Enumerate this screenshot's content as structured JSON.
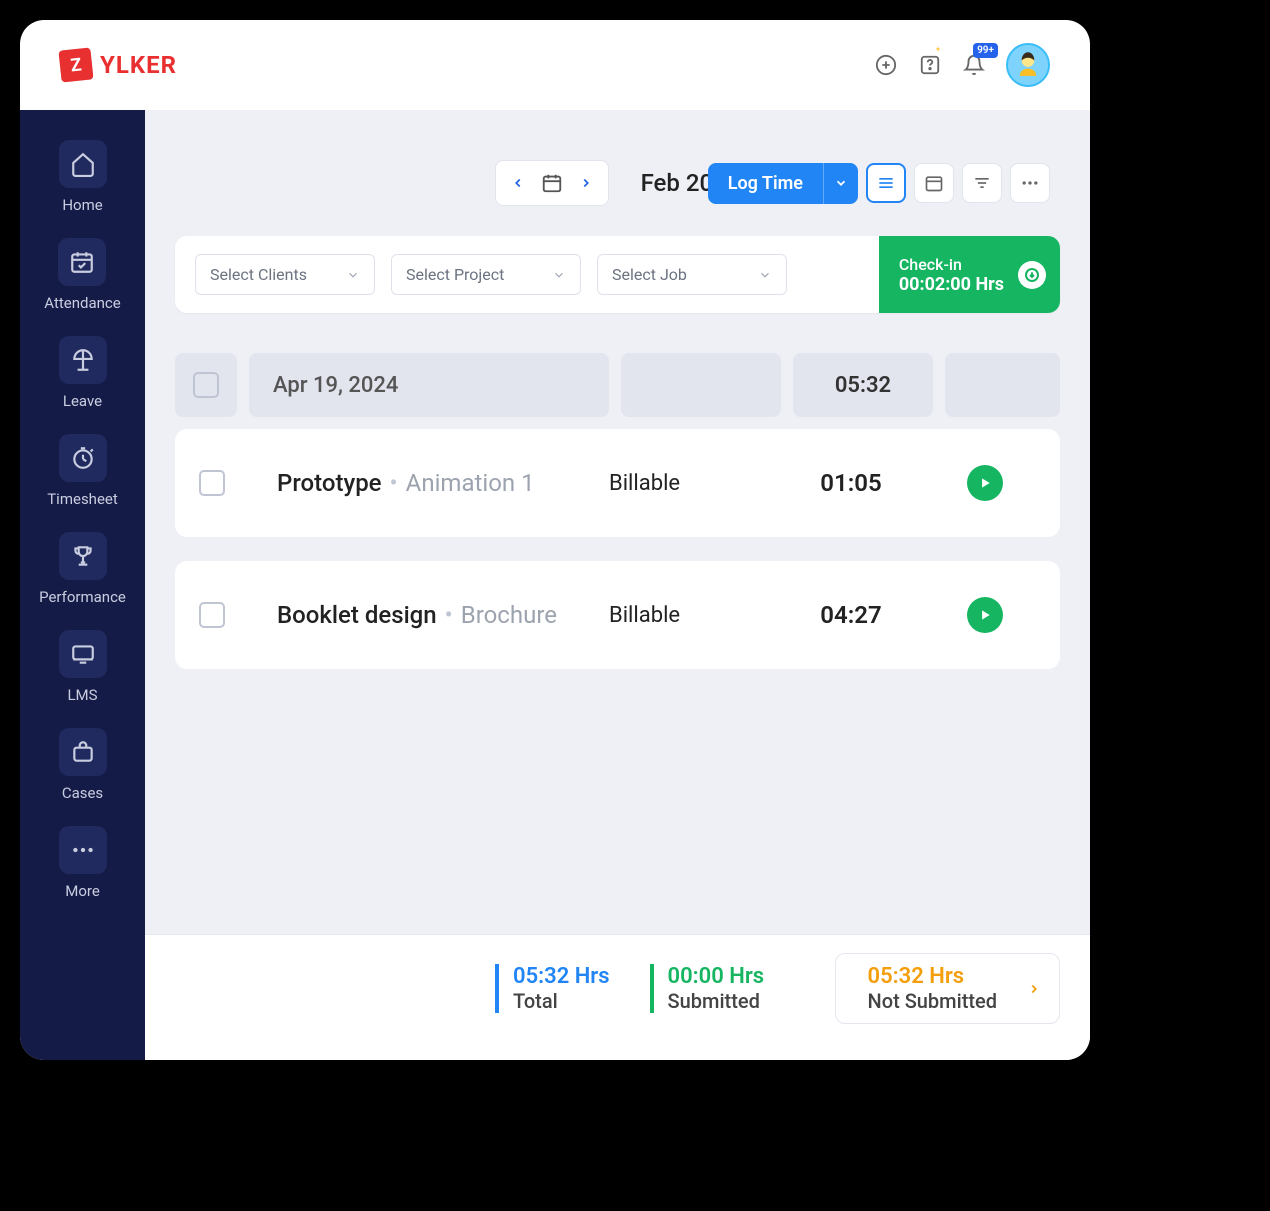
{
  "logo": {
    "letter": "Z",
    "text": "YLKER"
  },
  "header": {
    "notification_badge": "99+"
  },
  "sidebar": {
    "items": [
      {
        "label": "Home"
      },
      {
        "label": "Attendance"
      },
      {
        "label": "Leave"
      },
      {
        "label": "Timesheet"
      },
      {
        "label": "Performance"
      },
      {
        "label": "LMS"
      },
      {
        "label": "Cases"
      },
      {
        "label": "More"
      }
    ]
  },
  "period": {
    "label": "Feb 2024"
  },
  "toolbar": {
    "log_time": "Log Time"
  },
  "filters": {
    "clients": "Select Clients",
    "project": "Select Project",
    "job": "Select Job"
  },
  "checkin": {
    "label": "Check-in",
    "time": "00:02:00 Hrs"
  },
  "date_group": {
    "date": "Apr 19, 2024",
    "total": "05:32"
  },
  "entries": [
    {
      "name": "Prototype",
      "sub": "Animation 1",
      "billable": "Billable",
      "time": "01:05"
    },
    {
      "name": "Booklet design",
      "sub": "Brochure",
      "billable": "Billable",
      "time": "04:27"
    }
  ],
  "footer": {
    "total": {
      "value": "05:32 Hrs",
      "label": "Total"
    },
    "submitted": {
      "value": "00:00 Hrs",
      "label": "Submitted"
    },
    "not_submitted": {
      "value": "05:32 Hrs",
      "label": "Not Submitted"
    }
  }
}
